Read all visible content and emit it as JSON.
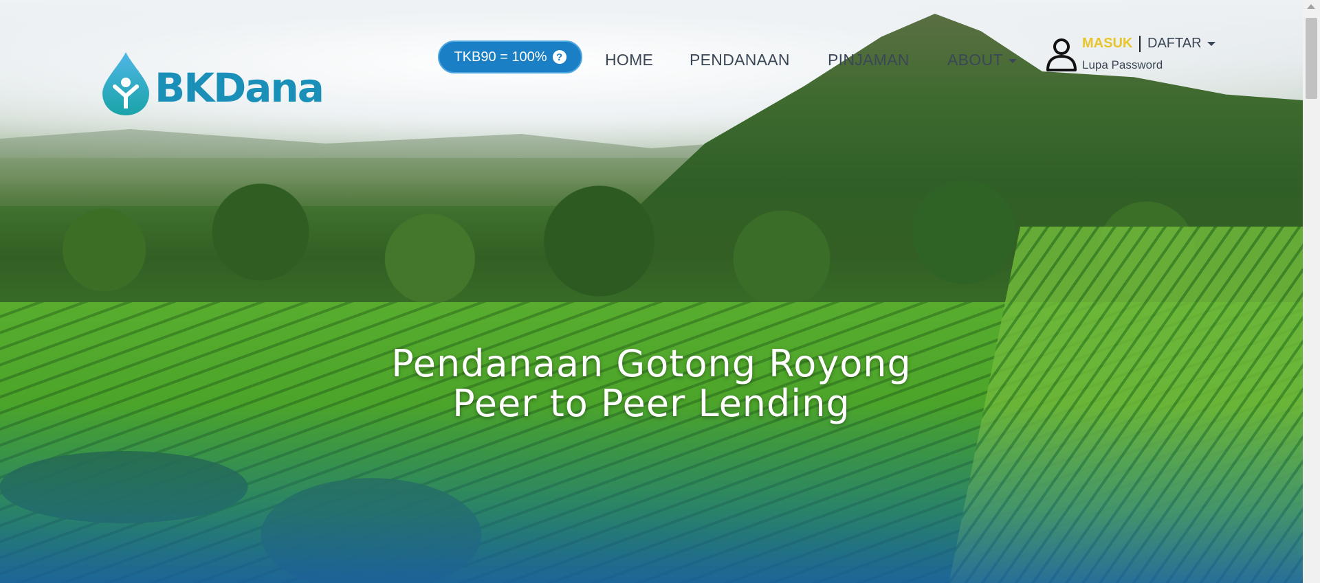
{
  "brand": {
    "name": "BKDana"
  },
  "nav": {
    "tkb_label": "TKB90 = 100%",
    "help_glyph": "?",
    "items": [
      "HOME",
      "PENDANAAN",
      "PINJAMAN",
      "ABOUT"
    ]
  },
  "account": {
    "login": "MASUK",
    "register": "DAFTAR",
    "forgot": "Lupa Password"
  },
  "hero": {
    "line1": "Pendanaan Gotong Royong",
    "line2": "Peer to Peer Lending"
  },
  "colors": {
    "brand": "#1a8fb8",
    "tkb_bg": "#1a7fc4",
    "login_accent": "#e8c52a",
    "nav_text": "#3b4756"
  },
  "icons": [
    "user-icon",
    "help-icon",
    "drop-icon",
    "chevron-down-icon"
  ]
}
